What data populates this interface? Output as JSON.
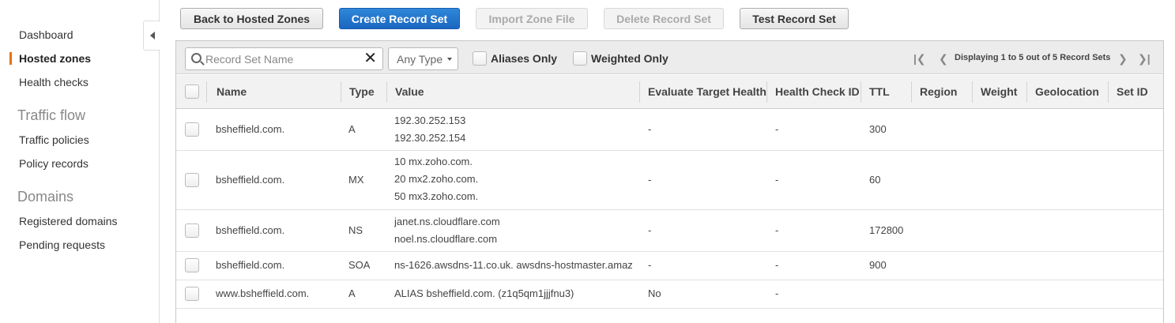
{
  "sidebar": {
    "items": [
      {
        "label": "Dashboard",
        "active": false
      },
      {
        "label": "Hosted zones",
        "active": true
      },
      {
        "label": "Health checks",
        "active": false
      }
    ],
    "traffic_flow": {
      "heading": "Traffic flow",
      "items": [
        {
          "label": "Traffic policies"
        },
        {
          "label": "Policy records"
        }
      ]
    },
    "domains": {
      "heading": "Domains",
      "items": [
        {
          "label": "Registered domains"
        },
        {
          "label": "Pending requests"
        }
      ]
    },
    "collapse_icon": "chevron-left-icon"
  },
  "toolbar": {
    "back": "Back to Hosted Zones",
    "create": "Create Record Set",
    "import": "Import Zone File",
    "delete": "Delete Record Set",
    "test": "Test Record Set",
    "primary_color": "#1f6fc9"
  },
  "filters": {
    "search_placeholder": "Record Set Name",
    "search_value": "",
    "type_select": "Any Type",
    "aliases_only": "Aliases Only",
    "weighted_only": "Weighted Only",
    "pagination": "Displaying 1 to 5 out of 5 Record Sets"
  },
  "table": {
    "columns": [
      "Name",
      "Type",
      "Value",
      "Evaluate Target Health",
      "Health Check ID",
      "TTL",
      "Region",
      "Weight",
      "Geolocation",
      "Set ID"
    ],
    "rows": [
      {
        "name": "bsheffield.com.",
        "type": "A",
        "value": [
          "192.30.252.153",
          "192.30.252.154"
        ],
        "eval": "-",
        "hc": "-",
        "ttl": "300"
      },
      {
        "name": "bsheffield.com.",
        "type": "MX",
        "value": [
          "10 mx.zoho.com.",
          "20 mx2.zoho.com.",
          "50 mx3.zoho.com."
        ],
        "eval": "-",
        "hc": "-",
        "ttl": "60"
      },
      {
        "name": "bsheffield.com.",
        "type": "NS",
        "value": [
          "janet.ns.cloudflare.com",
          "noel.ns.cloudflare.com"
        ],
        "eval": "-",
        "hc": "-",
        "ttl": "172800"
      },
      {
        "name": "bsheffield.com.",
        "type": "SOA",
        "value": [
          "ns-1626.awsdns-11.co.uk. awsdns-hostmaster.amaz"
        ],
        "eval": "-",
        "hc": "-",
        "ttl": "900"
      },
      {
        "name": "www.bsheffield.com.",
        "type": "A",
        "value": [
          "ALIAS bsheffield.com. (z1q5qm1jjjfnu3)"
        ],
        "eval": "No",
        "hc": "-",
        "ttl": ""
      }
    ]
  }
}
